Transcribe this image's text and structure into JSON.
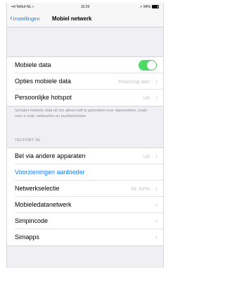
{
  "status_bar": {
    "carrier": "••ll Telfort NL ▿",
    "time": "15:29",
    "battery_text": "↗ 94%"
  },
  "nav": {
    "back_label": "Instellingen",
    "title": "Mobiel netwerk"
  },
  "group1": {
    "items": [
      {
        "label": "Mobiele data",
        "toggle_on": true
      },
      {
        "label": "Opties mobiele data",
        "value": "Roaming aan"
      },
      {
        "label": "Persoonlijke hotspot",
        "value": "Uit"
      }
    ]
  },
  "footer_note": "Schakel mobiele data uit om alleen wifi te gebruiken voor dataverkeer, zoals voor e-mail, websurfen en pushberichten.",
  "section_header": "TELFORT NL",
  "group2": {
    "items": [
      {
        "label": "Bel via andere apparaten",
        "value": "Uit"
      },
      {
        "label": "Voorzieningen aanbieder"
      },
      {
        "label": "Netwerkselectie",
        "value": "NL KPN"
      },
      {
        "label": "Mobieledatanetwerk"
      },
      {
        "label": "Simpincode"
      },
      {
        "label": "Simapps"
      }
    ]
  },
  "colors": {
    "accent": "#157efb",
    "toggle_on": "#4cd964",
    "background": "#efeff4"
  }
}
